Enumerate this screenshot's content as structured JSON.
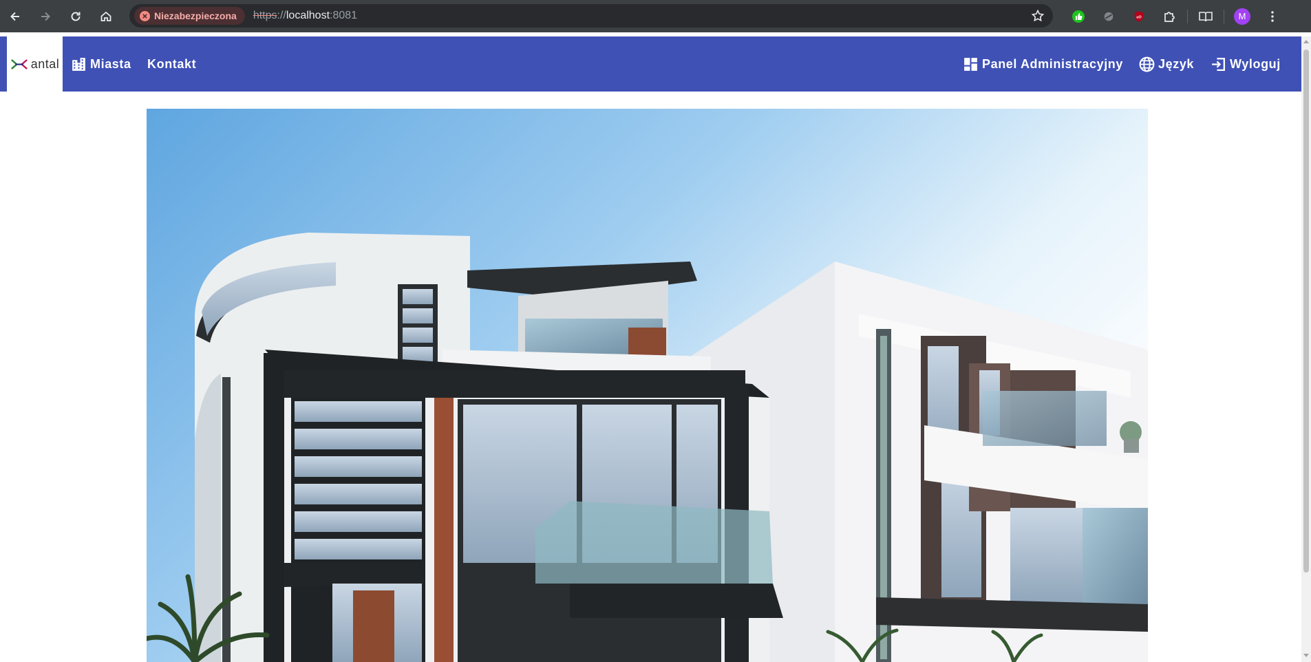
{
  "browser": {
    "security_label": "Niezabezpieczona",
    "url_scheme": "https",
    "url_sep": "://",
    "url_host": "localhost",
    "url_port": ":8081",
    "profile_initial": "M"
  },
  "nav": {
    "logo_text": "antal",
    "links": {
      "cities": "Miasta",
      "contact": "Kontakt",
      "admin_panel": "Panel Administracyjny",
      "language": "Język",
      "logout": "Wyloguj"
    },
    "bar_color": "#3f51b5"
  },
  "hero": {
    "image": "modern-white-house-photo"
  }
}
